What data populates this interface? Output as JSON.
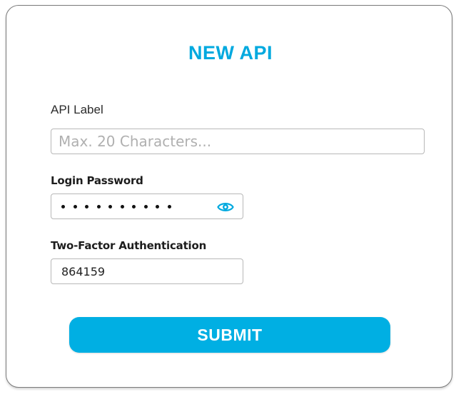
{
  "form": {
    "title": "NEW API",
    "api_label": {
      "label": "API Label",
      "placeholder": "Max. 20 Characters...",
      "value": ""
    },
    "password": {
      "label": "Login Password",
      "masked_length": 10,
      "toggle_icon": "eye-icon"
    },
    "two_factor": {
      "label": "Two-Factor Authentication",
      "value": "864159"
    },
    "submit_label": "SUBMIT"
  },
  "colors": {
    "accent": "#00a9df",
    "button": "#00afe3",
    "border": "#b8b8b8"
  }
}
